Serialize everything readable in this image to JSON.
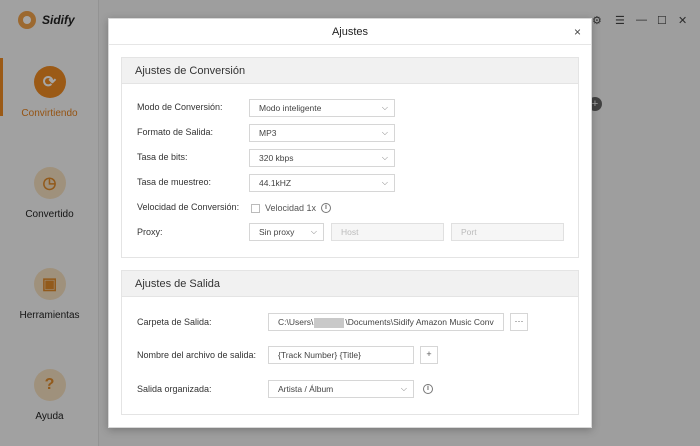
{
  "app": {
    "brand": "Sidify",
    "nav": [
      {
        "label": "Convirtiendo",
        "icon": "convert-icon"
      },
      {
        "label": "Convertido",
        "icon": "clock-icon"
      },
      {
        "label": "Herramientas",
        "icon": "toolbox-icon"
      },
      {
        "label": "Ayuda",
        "icon": "question-icon"
      }
    ]
  },
  "dialog": {
    "title": "Ajustes",
    "close": "×",
    "conversion": {
      "heading": "Ajustes de Conversión",
      "mode_label": "Modo de Conversión:",
      "mode_value": "Modo inteligente",
      "format_label": "Formato de Salida:",
      "format_value": "MP3",
      "bitrate_label": "Tasa de bits:",
      "bitrate_value": "320 kbps",
      "samplerate_label": "Tasa de muestreo:",
      "samplerate_value": "44.1kHZ",
      "speed_label": "Velocidad de Conversión:",
      "speed_option": "Velocidad 1x",
      "proxy_label": "Proxy:",
      "proxy_value": "Sin proxy",
      "host_placeholder": "Host",
      "port_placeholder": "Port"
    },
    "output": {
      "heading": "Ajustes de Salida",
      "folder_label": "Carpeta de Salida:",
      "folder_prefix": "C:\\Users\\",
      "folder_suffix": "\\Documents\\Sidify Amazon Music Conv",
      "browse": "···",
      "filename_label": "Nombre del archivo de salida:",
      "filename_value": "{Track Number} {Title}",
      "add": "+",
      "organized_label": "Salida organizada:",
      "organized_value": "Artista / Álbum"
    }
  }
}
